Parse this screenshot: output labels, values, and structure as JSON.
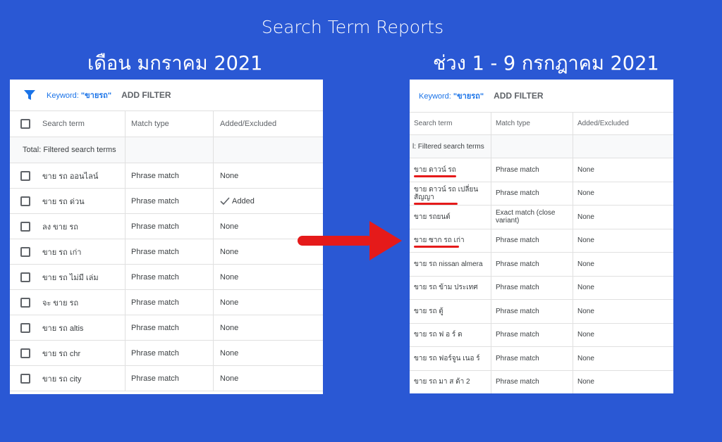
{
  "title": "Search Term Reports",
  "left_heading": "เดือน มกราคม 2021",
  "right_heading": "ช่วง 1 - 9 กรกฎาคม 2021",
  "colors": {
    "background": "#2a58d4",
    "accent": "#1a73e8",
    "highlight": "#e51a1a"
  },
  "left_panel": {
    "keyword_prefix": "Keyword: ",
    "keyword_value": "\"ขายรถ\"",
    "add_filter": "ADD FILTER",
    "headers": [
      "Search term",
      "Match type",
      "Added/Excluded"
    ],
    "total": "Total: Filtered search terms",
    "rows": [
      {
        "term": "ขาย รถ ออนไลน์",
        "match": "Phrase match",
        "status": "None"
      },
      {
        "term": "ขาย รถ ด่วน",
        "match": "Phrase match",
        "status": "Added"
      },
      {
        "term": "ลง ขาย รถ",
        "match": "Phrase match",
        "status": "None"
      },
      {
        "term": "ขาย รถ เก่า",
        "match": "Phrase match",
        "status": "None"
      },
      {
        "term": "ขาย รถ ไม่มี เล่ม",
        "match": "Phrase match",
        "status": "None"
      },
      {
        "term": "จะ ขาย รถ",
        "match": "Phrase match",
        "status": "None"
      },
      {
        "term": "ขาย รถ altis",
        "match": "Phrase match",
        "status": "None"
      },
      {
        "term": "ขาย รถ chr",
        "match": "Phrase match",
        "status": "None"
      },
      {
        "term": "ขาย รถ city",
        "match": "Phrase match",
        "status": "None"
      }
    ]
  },
  "right_panel": {
    "keyword_prefix": "Keyword: ",
    "keyword_value": "\"ขายรถ\"",
    "add_filter": "ADD FILTER",
    "headers": [
      "Search term",
      "Match type",
      "Added/Excluded"
    ],
    "total": "l: Filtered search terms",
    "rows": [
      {
        "term": "ขาย ดาวน์ รถ",
        "match": "Phrase match",
        "status": "None"
      },
      {
        "term": "ขาย ดาวน์ รถ เปลี่ยน สัญญา",
        "match": "Phrase match",
        "status": "None"
      },
      {
        "term": "ขาย รถยนต์",
        "match": "Exact match (close variant)",
        "status": "None"
      },
      {
        "term": "ขาย ซาก รถ เก่า",
        "match": "Phrase match",
        "status": "None"
      },
      {
        "term": "ขาย รถ nissan almera",
        "match": "Phrase match",
        "status": "None"
      },
      {
        "term": "ขาย รถ ข้าม ประเทศ",
        "match": "Phrase match",
        "status": "None"
      },
      {
        "term": "ขาย รถ ตู้",
        "match": "Phrase match",
        "status": "None"
      },
      {
        "term": "ขาย รถ ฟ อ ร์ ด",
        "match": "Phrase match",
        "status": "None"
      },
      {
        "term": "ขาย รถ ฟอร์จูน เนอ ร์",
        "match": "Phrase match",
        "status": "None"
      },
      {
        "term": "ขาย รถ มา ส ด้า 2",
        "match": "Phrase match",
        "status": "None"
      }
    ]
  },
  "icons": {
    "filter": "filter-icon",
    "check": "check-icon",
    "arrow": "right-arrow-icon"
  }
}
